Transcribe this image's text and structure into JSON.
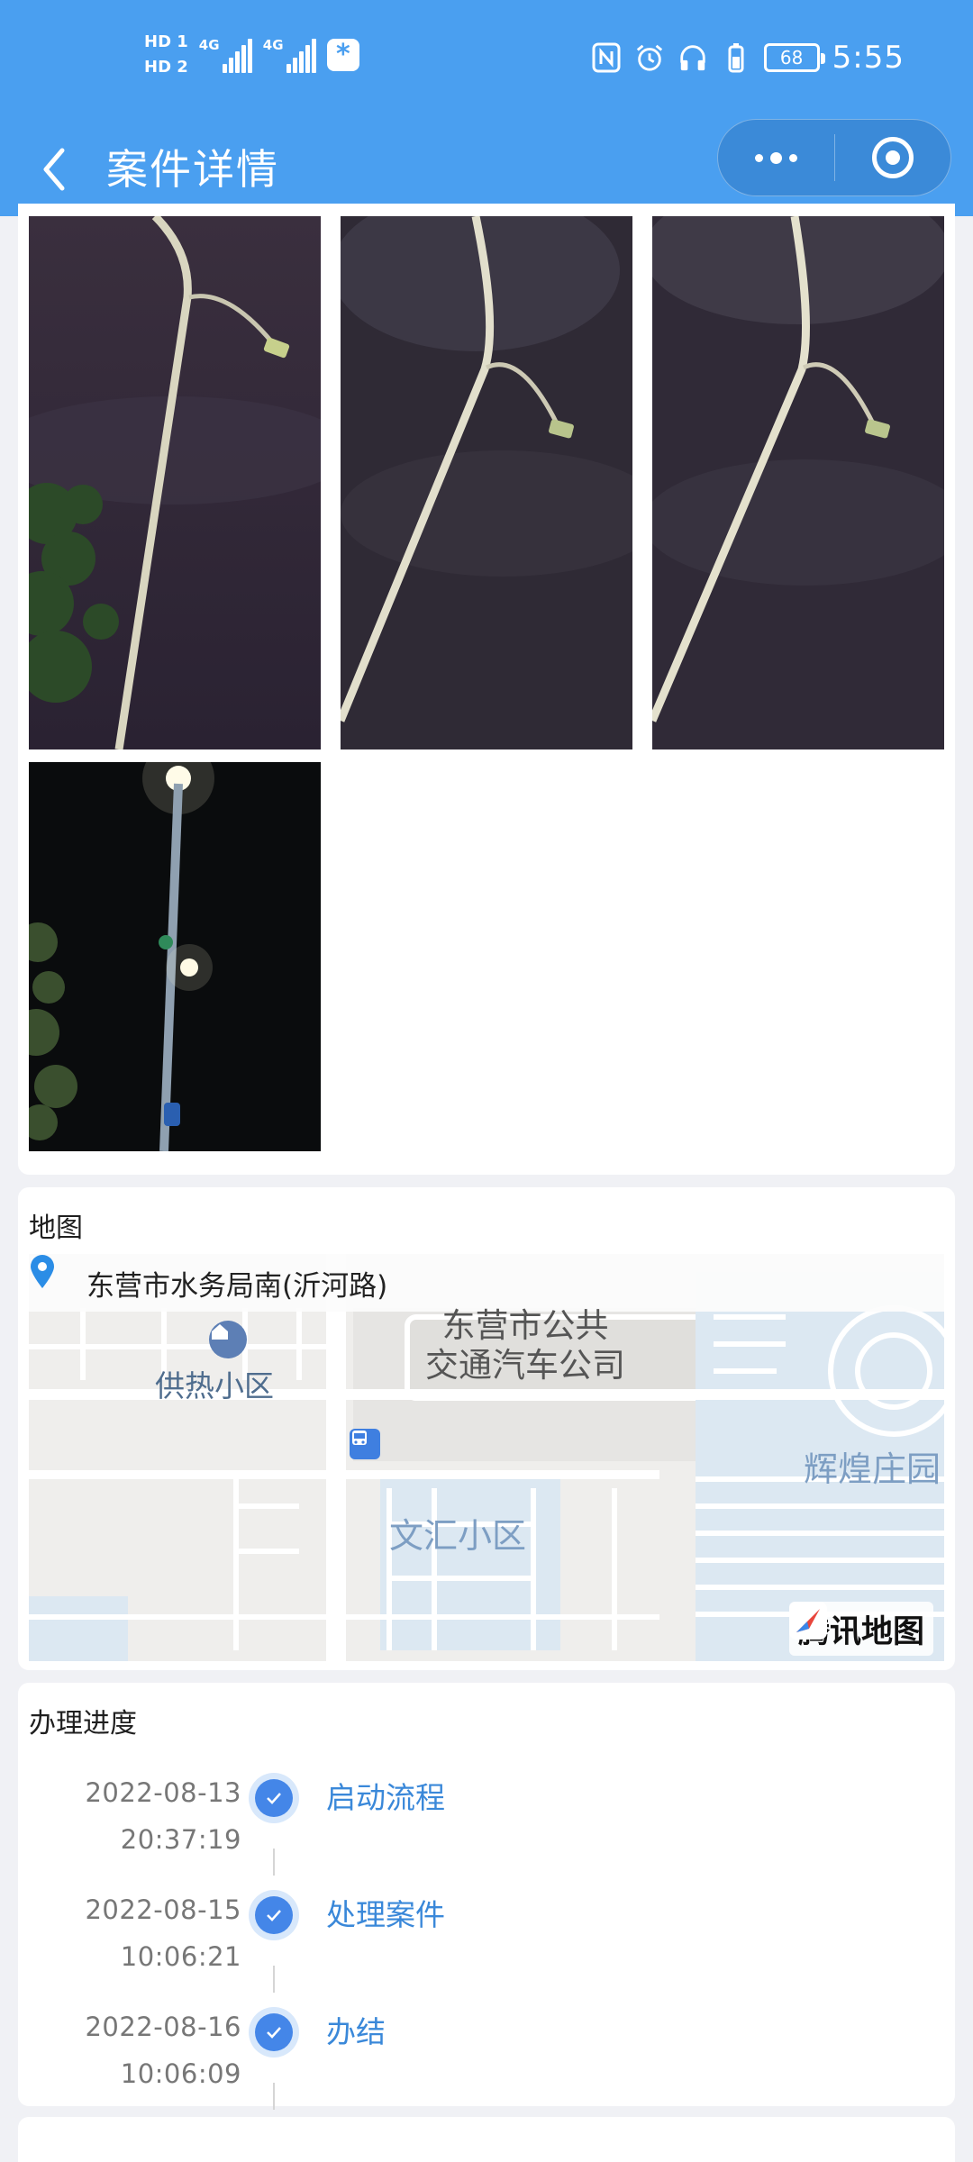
{
  "status_bar": {
    "sim1": "HD 1",
    "sim2": "HD 2",
    "net1": "4G",
    "net2": "4G",
    "battery": "68",
    "time": "5:55"
  },
  "nav": {
    "title": "案件详情"
  },
  "map": {
    "section_title": "地图",
    "address": "东营市水务局南(沂河路)",
    "labels": {
      "company": "东营市公共\n交通汽车公司",
      "heating": "供热小区",
      "wenhui": "文汇小区",
      "huihuang": "辉煌庄园"
    },
    "provider": "腾讯地图"
  },
  "progress": {
    "section_title": "办理进度",
    "steps": [
      {
        "date": "2022-08-13",
        "time": "20:37:19",
        "label": "启动流程"
      },
      {
        "date": "2022-08-15",
        "time": "10:06:21",
        "label": "处理案件"
      },
      {
        "date": "2022-08-16",
        "time": "10:06:09",
        "label": "办结"
      }
    ]
  },
  "colors": {
    "header": "#4a9ff0",
    "accent": "#3a88d9",
    "step_dot": "#4486e8"
  }
}
